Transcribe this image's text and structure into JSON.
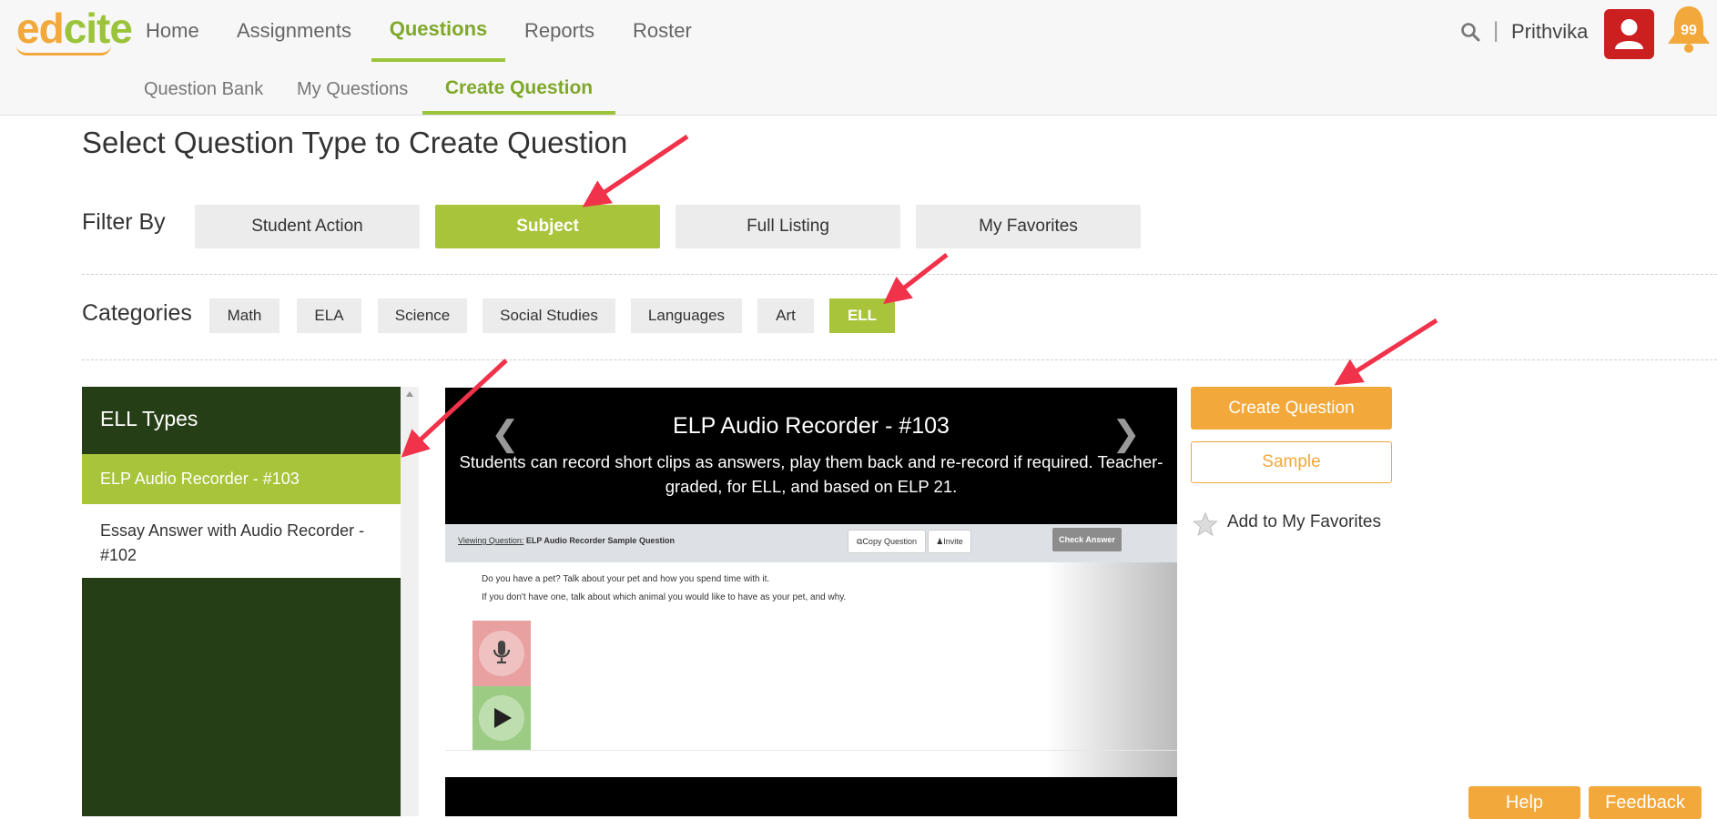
{
  "brand": {
    "part1": "ed",
    "part2": "cite"
  },
  "nav": {
    "items": [
      {
        "label": "Home"
      },
      {
        "label": "Assignments"
      },
      {
        "label": "Questions",
        "active": true
      },
      {
        "label": "Reports"
      },
      {
        "label": "Roster"
      }
    ]
  },
  "user": {
    "name": "Prithvika",
    "separator": "|",
    "notifications": "99"
  },
  "subnav": {
    "items": [
      {
        "label": "Question Bank"
      },
      {
        "label": "My Questions"
      },
      {
        "label": "Create Question",
        "active": true
      }
    ]
  },
  "page": {
    "title": "Select Question Type to Create Question"
  },
  "filter": {
    "label": "Filter By",
    "options": [
      "Student Action",
      "Subject",
      "Full Listing",
      "My Favorites"
    ],
    "selected": "Subject"
  },
  "categories": {
    "label": "Categories",
    "items": [
      "Math",
      "ELA",
      "Science",
      "Social Studies",
      "Languages",
      "Art",
      "ELL"
    ],
    "selected": "ELL"
  },
  "types": {
    "title": "ELL Types",
    "items": [
      "ELP Audio Recorder - #103",
      "Essay Answer with Audio Recorder - #102"
    ],
    "selected": "ELP Audio Recorder - #103"
  },
  "preview": {
    "title": "ELP Audio Recorder - #103",
    "description": "Students can record short clips as answers, play them back and re-record if required. Teacher-graded, for ELL, and based on ELP 21.",
    "prev_symbol": "❮",
    "next_symbol": "❯",
    "screenshot": {
      "viewing_label": "Viewing Question:",
      "viewing_title": "ELP Audio Recorder Sample Question",
      "copy_label": "Copy Question",
      "invite_label": "Invite",
      "check_label": "Check Answer",
      "line1": "Do you have a pet? Talk about your pet and how you spend time with it.",
      "line2": "If you don't have one, talk about which animal you would like to have as your pet, and why."
    }
  },
  "actions": {
    "create": "Create Question",
    "sample": "Sample",
    "favorite": "Add to My Favorites"
  },
  "footer": {
    "help": "Help",
    "feedback": "Feedback"
  },
  "colors": {
    "brand_green": "#a8c43a",
    "brand_orange": "#f2a83a",
    "panel_dark": "#263e15",
    "annotation_arrow": "#f0324a"
  },
  "icons": [
    "search-icon",
    "user-icon",
    "bell-icon",
    "star-icon",
    "microphone-icon",
    "play-icon",
    "copy-icon",
    "person-icon"
  ]
}
